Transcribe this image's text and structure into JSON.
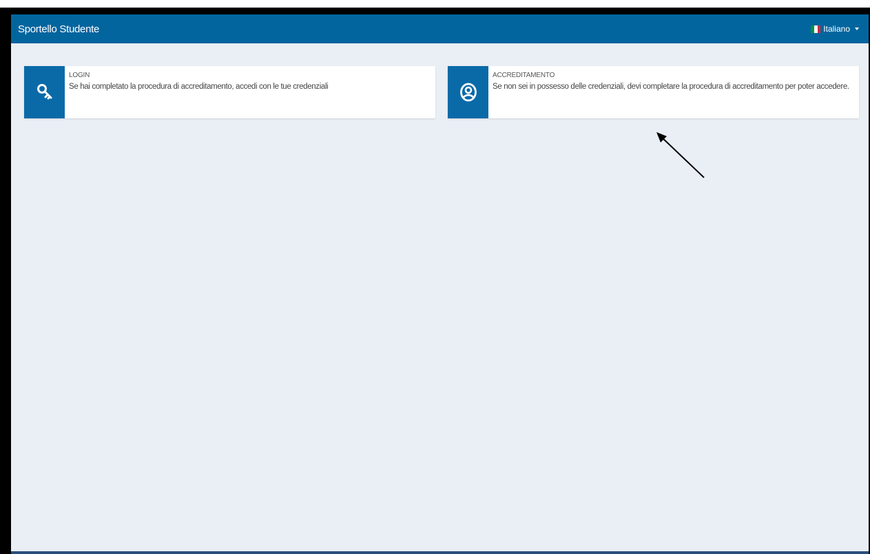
{
  "navbar": {
    "brand": "Sportello Studente",
    "language": {
      "selected": "Italiano",
      "flag_colors": [
        "#009246",
        "#ffffff",
        "#ce2b37"
      ]
    }
  },
  "cards": [
    {
      "title": "LOGIN",
      "text": "Se hai completato la procedura di accreditamento, accedi con le tue credenziali",
      "icon": "key-icon"
    },
    {
      "title": "ACCREDITAMENTO",
      "text": "Se non sei in possesso delle credenziali, devi completare la procedura di accreditamento per poter accedere.",
      "icon": "user-icon"
    }
  ],
  "colors": {
    "navbar": "#03659e",
    "card_icon_bg": "#0a6aa8",
    "page_bg": "#eaeef5"
  }
}
